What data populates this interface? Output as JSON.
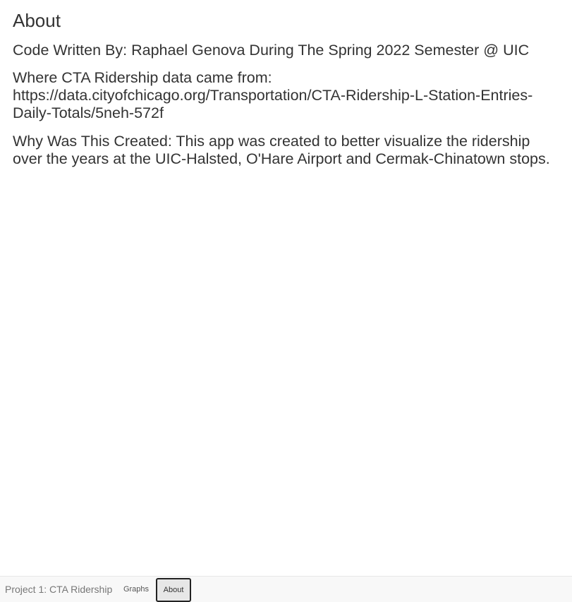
{
  "main": {
    "title": "About",
    "paragraphs": [
      "Code Written By: Raphael Genova During The Spring 2022 Semester @ UIC",
      "Where CTA Ridership data came from: https://data.cityofchicago.org/Transportation/CTA-Ridership-L-Station-Entries-Daily-Totals/5neh-572f",
      "Why Was This Created: This app was created to better visualize the ridership over the years at the UIC-Halsted, O'Hare Airport and Cermak-Chinatown stops."
    ]
  },
  "navbar": {
    "brand": "Project 1: CTA Ridership",
    "tabs": [
      {
        "label": "Graphs",
        "active": false
      },
      {
        "label": "About",
        "active": true
      }
    ]
  },
  "colors": {
    "text": "#333333",
    "navbar_bg": "#f8f8f8",
    "active_tab_bg": "#e7e7e7",
    "brand_text": "#777777"
  }
}
